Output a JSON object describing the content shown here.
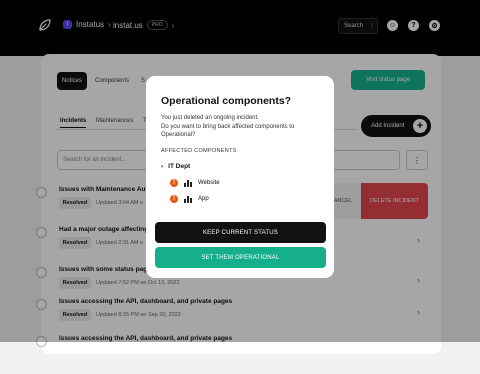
{
  "topbar": {
    "workspace_badge": "I",
    "workspace": "Instatus",
    "page": "instat.us",
    "plan": "PRO",
    "search_label": "Search",
    "search_shortcut": "/"
  },
  "tabs": [
    "Notices",
    "Components",
    "S"
  ],
  "visit_button": "Visit status page",
  "subtabs": [
    "Incidents",
    "Maintenances",
    "T"
  ],
  "add_incident": "Add Incident",
  "search_placeholder": "Search for an incident...",
  "rows": [
    {
      "title": "Issues with Maintenance Aut",
      "status": "Resolved",
      "updated": "Updated 3:04 AM o"
    },
    {
      "title": "Had a major outage affecting",
      "status": "Resolved",
      "updated": "Updated 2:31 AM o"
    },
    {
      "title": "Issues with some status pag",
      "status": "Resolved",
      "updated": "Updated 7:52 PM on Oct 13, 2022"
    },
    {
      "title": "Issues accessing the API, dashboard, and private pages",
      "status": "Resolved",
      "updated": "Updated 8:35 PM on Sep 20, 2022"
    },
    {
      "title": "Issues accessing the API, dashboard, and private pages",
      "status": "",
      "updated": ""
    }
  ],
  "swipe": {
    "cancel": "CANCEL",
    "delete": "DELETE INCIDENT"
  },
  "modal": {
    "title": "Operational components?",
    "line1": "You just deleted an ongoing incident.",
    "line2": "Do you want to bring back affected components to Operational?",
    "section": "AFFECTED COMPONENTS",
    "group": "IT Dept",
    "components": [
      "Website",
      "App"
    ],
    "keep_button": "KEEP CURRENT STATUS",
    "set_button": "SET THEM OPERATIONAL"
  },
  "colors": {
    "accent": "#15b08b",
    "danger": "#e5484d",
    "warning": "#e8590c"
  }
}
